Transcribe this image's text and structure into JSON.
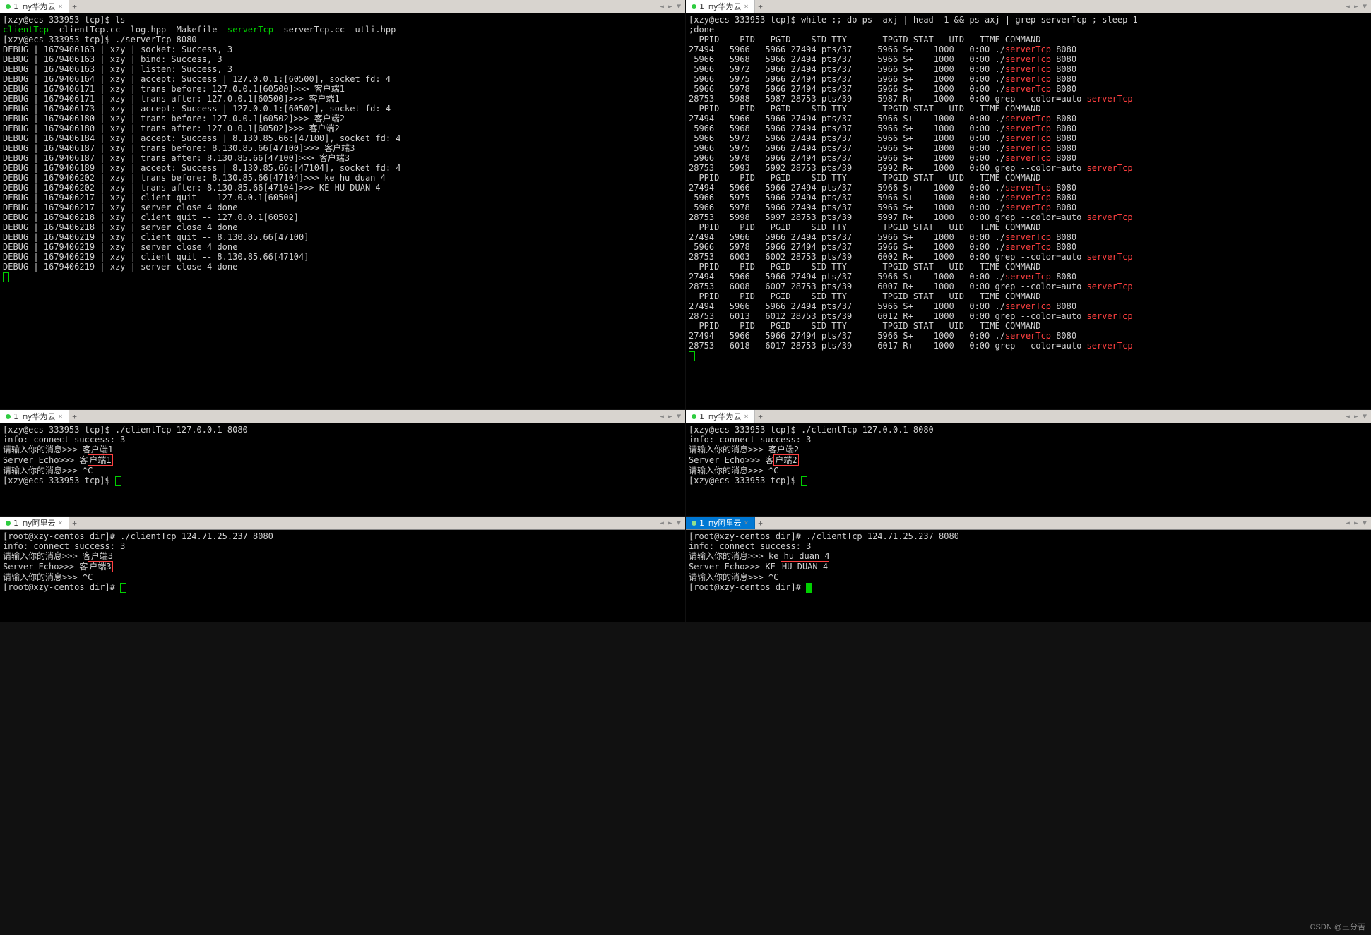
{
  "tabs": {
    "huawei": "1 my华为云",
    "ali": "1 my阿里云"
  },
  "watermark": "CSDN @三分苦",
  "p1": {
    "l1": "[xzy@ecs-333953 tcp]$ ls",
    "files_green1": "clientTcp",
    "files_plain1": "  clientTcp.cc  log.hpp  Makefile  ",
    "files_green2": "serverTcp",
    "files_plain2": "  serverTcp.cc  utli.hpp",
    "l2": "[xzy@ecs-333953 tcp]$ ./serverTcp 8080",
    "d": [
      "DEBUG | 1679406163 | xzy | socket: Success, 3",
      "DEBUG | 1679406163 | xzy | bind: Success, 3",
      "DEBUG | 1679406163 | xzy | listen: Success, 3",
      "DEBUG | 1679406164 | xzy | accept: Success | 127.0.0.1:[60500], socket fd: 4",
      "DEBUG | 1679406171 | xzy | trans before: 127.0.0.1[60500]>>> 客户端1",
      "DEBUG | 1679406171 | xzy | trans after: 127.0.0.1[60500]>>> 客户端1",
      "DEBUG | 1679406173 | xzy | accept: Success | 127.0.0.1:[60502], socket fd: 4",
      "DEBUG | 1679406180 | xzy | trans before: 127.0.0.1[60502]>>> 客户端2",
      "DEBUG | 1679406180 | xzy | trans after: 127.0.0.1[60502]>>> 客户端2",
      "DEBUG | 1679406184 | xzy | accept: Success | 8.130.85.66:[47100], socket fd: 4",
      "DEBUG | 1679406187 | xzy | trans before: 8.130.85.66[47100]>>> 客户端3",
      "DEBUG | 1679406187 | xzy | trans after: 8.130.85.66[47100]>>> 客户端3",
      "DEBUG | 1679406189 | xzy | accept: Success | 8.130.85.66:[47104], socket fd: 4",
      "DEBUG | 1679406202 | xzy | trans before: 8.130.85.66[47104]>>> ke hu duan 4",
      "DEBUG | 1679406202 | xzy | trans after: 8.130.85.66[47104]>>> KE HU DUAN 4",
      "DEBUG | 1679406217 | xzy | client quit -- 127.0.0.1[60500]",
      "DEBUG | 1679406217 | xzy | server close 4 done",
      "DEBUG | 1679406218 | xzy | client quit -- 127.0.0.1[60502]",
      "DEBUG | 1679406218 | xzy | server close 4 done",
      "DEBUG | 1679406219 | xzy | client quit -- 8.130.85.66[47100]",
      "DEBUG | 1679406219 | xzy | server close 4 done",
      "DEBUG | 1679406219 | xzy | client quit -- 8.130.85.66[47104]",
      "DEBUG | 1679406219 | xzy | server close 4 done"
    ]
  },
  "p2": {
    "cmd": "[xzy@ecs-333953 tcp]$ while :; do ps -axj | head -1 && ps axj | grep serverTcp ; sleep 1",
    "cmd2": ";done",
    "hdr": "  PPID    PID   PGID    SID TTY       TPGID STAT   UID   TIME COMMAND",
    "blocks": [
      [
        [
          "27494   5966   5966 27494 pts/37     5966 S+    1000   0:00 ./",
          "serverTcp",
          " 8080"
        ],
        [
          " 5966   5968   5966 27494 pts/37     5966 S+    1000   0:00 ./",
          "serverTcp",
          " 8080"
        ],
        [
          " 5966   5972   5966 27494 pts/37     5966 S+    1000   0:00 ./",
          "serverTcp",
          " 8080"
        ],
        [
          " 5966   5975   5966 27494 pts/37     5966 S+    1000   0:00 ./",
          "serverTcp",
          " 8080"
        ],
        [
          " 5966   5978   5966 27494 pts/37     5966 S+    1000   0:00 ./",
          "serverTcp",
          " 8080"
        ],
        [
          "28753   5988   5987 28753 pts/39     5987 R+    1000   0:00 grep --color=auto ",
          "serverTcp",
          ""
        ]
      ],
      [
        [
          "27494   5966   5966 27494 pts/37     5966 S+    1000   0:00 ./",
          "serverTcp",
          " 8080"
        ],
        [
          " 5966   5968   5966 27494 pts/37     5966 S+    1000   0:00 ./",
          "serverTcp",
          " 8080"
        ],
        [
          " 5966   5972   5966 27494 pts/37     5966 S+    1000   0:00 ./",
          "serverTcp",
          " 8080"
        ],
        [
          " 5966   5975   5966 27494 pts/37     5966 S+    1000   0:00 ./",
          "serverTcp",
          " 8080"
        ],
        [
          " 5966   5978   5966 27494 pts/37     5966 S+    1000   0:00 ./",
          "serverTcp",
          " 8080"
        ],
        [
          "28753   5993   5992 28753 pts/39     5992 R+    1000   0:00 grep --color=auto ",
          "serverTcp",
          ""
        ]
      ],
      [
        [
          "27494   5966   5966 27494 pts/37     5966 S+    1000   0:00 ./",
          "serverTcp",
          " 8080"
        ],
        [
          " 5966   5975   5966 27494 pts/37     5966 S+    1000   0:00 ./",
          "serverTcp",
          " 8080"
        ],
        [
          " 5966   5978   5966 27494 pts/37     5966 S+    1000   0:00 ./",
          "serverTcp",
          " 8080"
        ],
        [
          "28753   5998   5997 28753 pts/39     5997 R+    1000   0:00 grep --color=auto ",
          "serverTcp",
          ""
        ]
      ],
      [
        [
          "27494   5966   5966 27494 pts/37     5966 S+    1000   0:00 ./",
          "serverTcp",
          " 8080"
        ],
        [
          " 5966   5978   5966 27494 pts/37     5966 S+    1000   0:00 ./",
          "serverTcp",
          " 8080"
        ],
        [
          "28753   6003   6002 28753 pts/39     6002 R+    1000   0:00 grep --color=auto ",
          "serverTcp",
          ""
        ]
      ],
      [
        [
          "27494   5966   5966 27494 pts/37     5966 S+    1000   0:00 ./",
          "serverTcp",
          " 8080"
        ],
        [
          "28753   6008   6007 28753 pts/39     6007 R+    1000   0:00 grep --color=auto ",
          "serverTcp",
          ""
        ]
      ],
      [
        [
          "27494   5966   5966 27494 pts/37     5966 S+    1000   0:00 ./",
          "serverTcp",
          " 8080"
        ],
        [
          "28753   6013   6012 28753 pts/39     6012 R+    1000   0:00 grep --color=auto ",
          "serverTcp",
          ""
        ]
      ],
      [
        [
          "27494   5966   5966 27494 pts/37     5966 S+    1000   0:00 ./",
          "serverTcp",
          " 8080"
        ],
        [
          "28753   6018   6017 28753 pts/39     6017 R+    1000   0:00 grep --color=auto ",
          "serverTcp",
          ""
        ]
      ]
    ]
  },
  "p3": {
    "l": [
      "[xzy@ecs-333953 tcp]$ ./clientTcp 127.0.0.1 8080",
      "info: connect success: 3",
      "请输入你的消息>>> 客户端1"
    ],
    "echo_pre": "Server Echo>>> 客",
    "echo_box": "户端1",
    "iq": "请输入你的消息>>> ^C",
    "p": "[xzy@ecs-333953 tcp]$ "
  },
  "p4": {
    "l": [
      "[xzy@ecs-333953 tcp]$ ./clientTcp 127.0.0.1 8080",
      "info: connect success: 3",
      "请输入你的消息>>> 客户端2"
    ],
    "echo_pre": "Server Echo>>> 客",
    "echo_box": "户端2",
    "iq": "请输入你的消息>>> ^C",
    "p": "[xzy@ecs-333953 tcp]$ "
  },
  "p5": {
    "l": [
      "[root@xzy-centos dir]# ./clientTcp 124.71.25.237 8080",
      "info: connect success: 3",
      "请输入你的消息>>> 客户端3"
    ],
    "echo_pre": "Server Echo>>> 客",
    "echo_box": "户端3",
    "iq": "请输入你的消息>>> ^C",
    "p": "[root@xzy-centos dir]# "
  },
  "p6": {
    "l": [
      "[root@xzy-centos dir]# ./clientTcp 124.71.25.237 8080",
      "info: connect success: 3",
      "请输入你的消息>>> ke hu duan 4"
    ],
    "echo_pre": "Server Echo>>> KE ",
    "echo_box": "HU DUAN 4",
    "iq": "请输入你的消息>>> ^C",
    "p": "[root@xzy-centos dir]# "
  }
}
